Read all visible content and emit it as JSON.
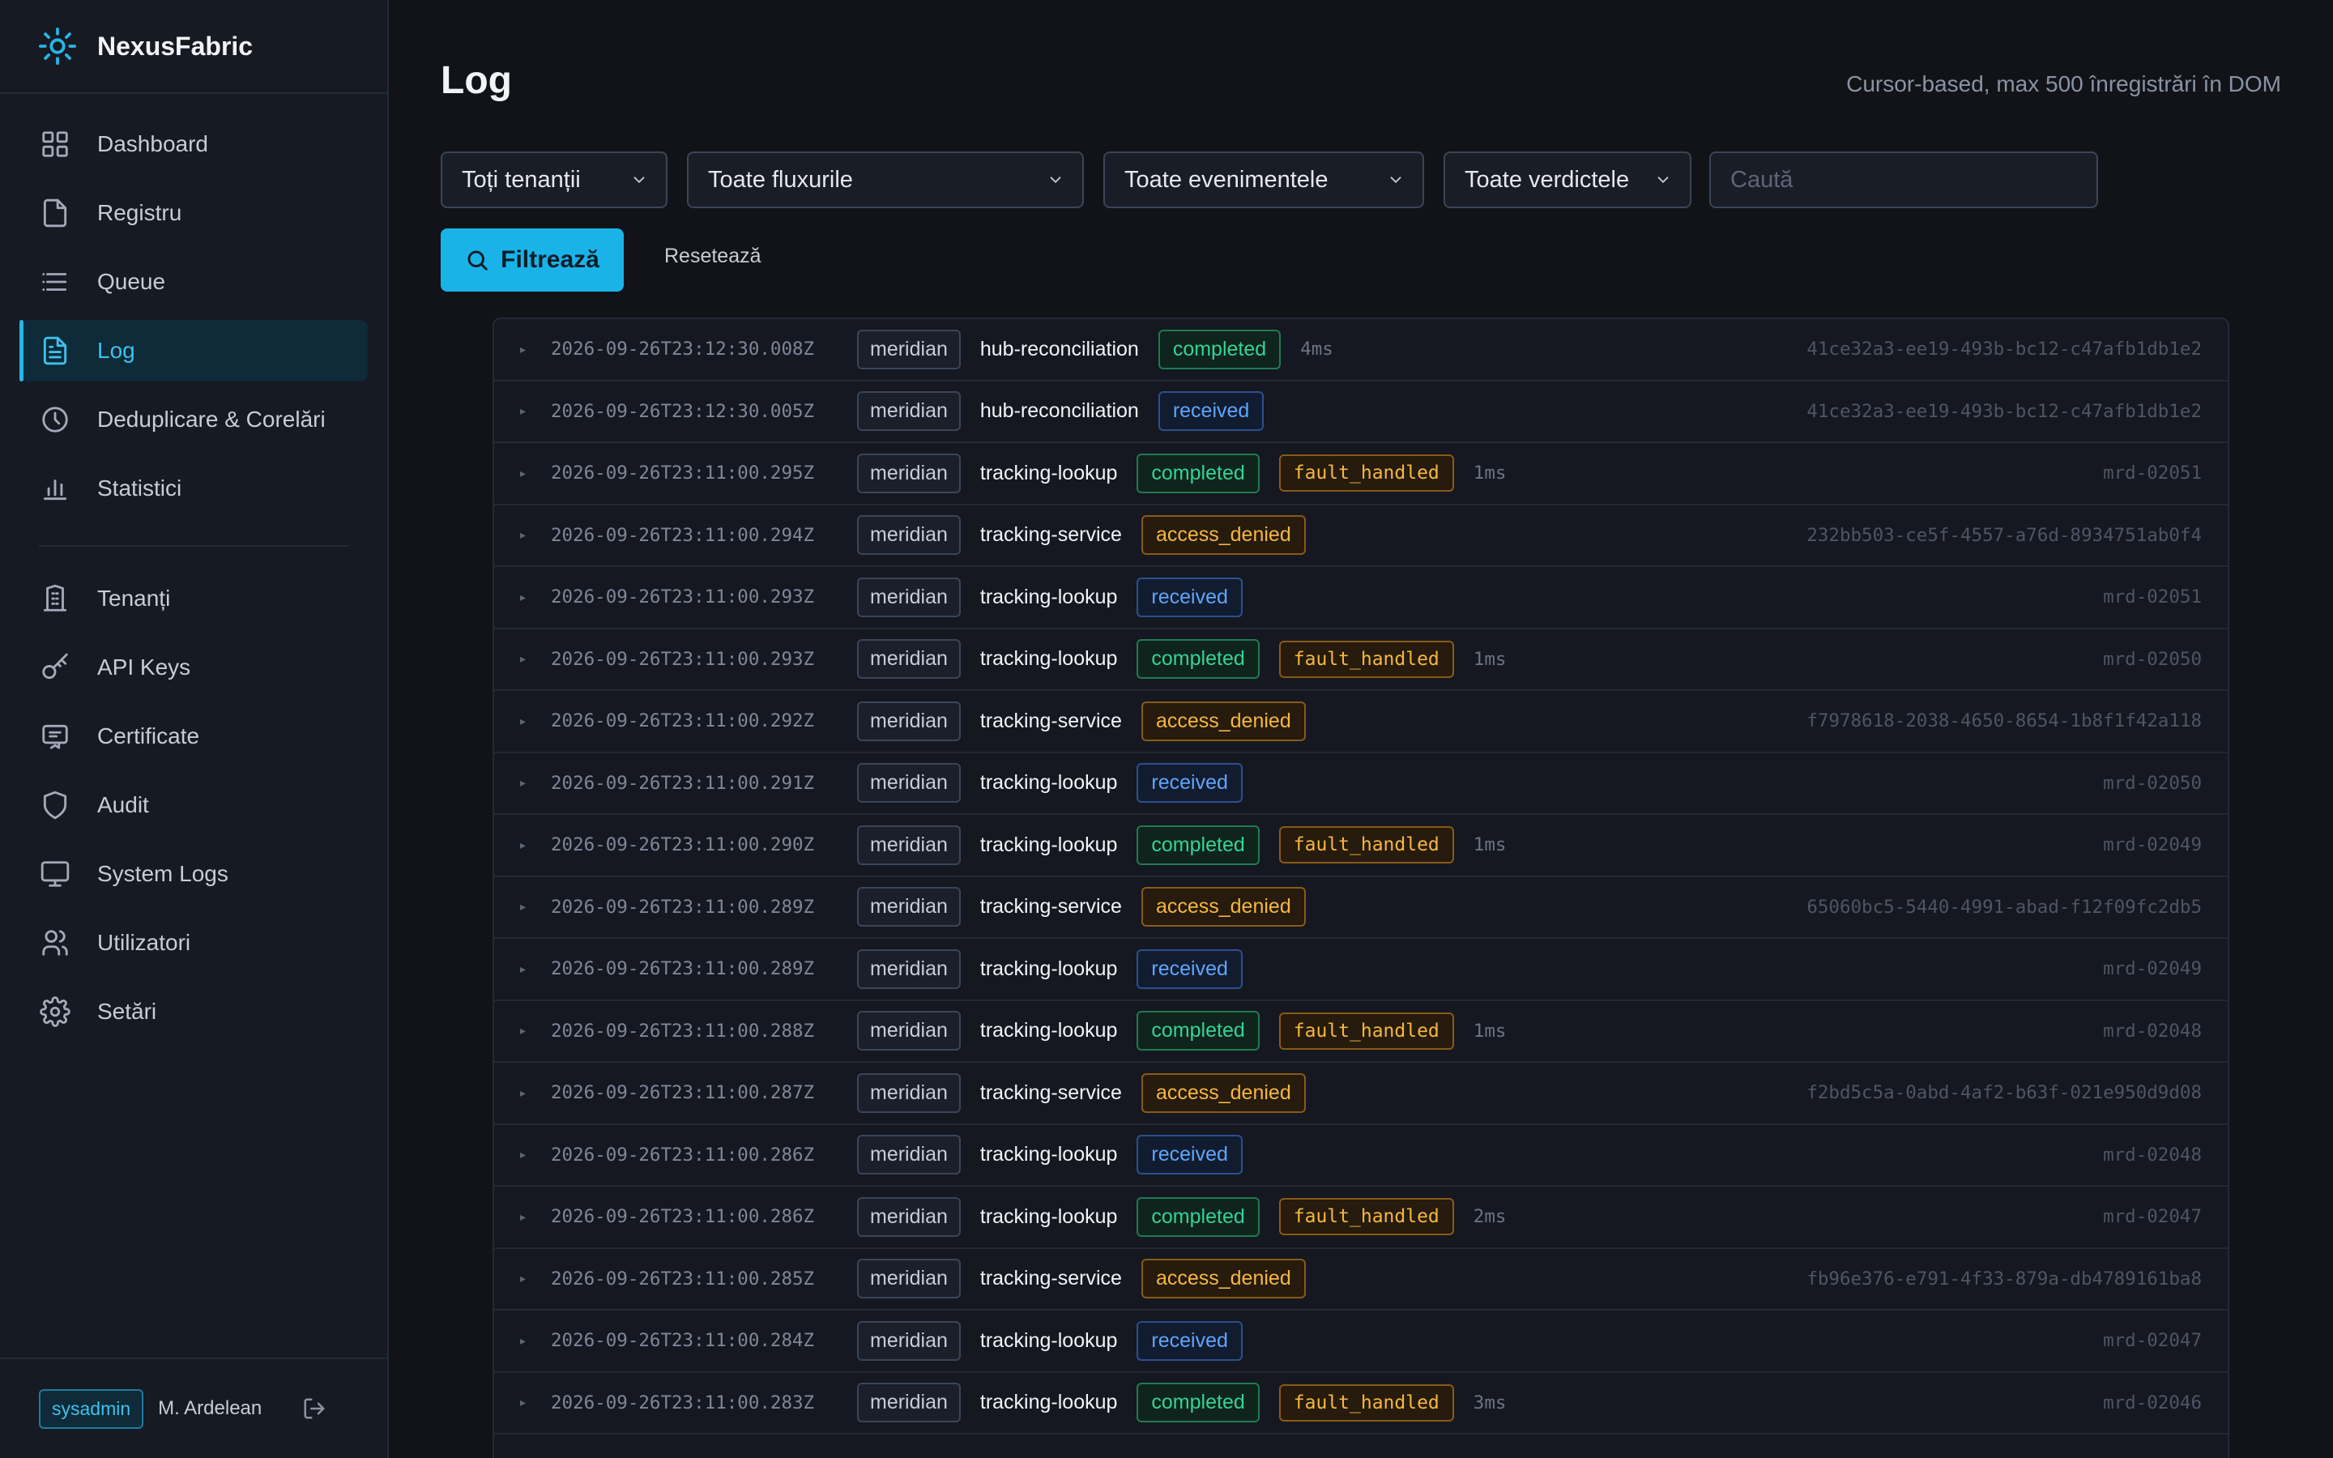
{
  "app": {
    "name": "NexusFabric"
  },
  "sidebar": {
    "main_items": [
      {
        "label": "Dashboard",
        "icon": "grid-icon"
      },
      {
        "label": "Registru",
        "icon": "file-icon"
      },
      {
        "label": "Queue",
        "icon": "list-icon"
      },
      {
        "label": "Log",
        "icon": "file-text-icon",
        "active": true
      },
      {
        "label": "Deduplicare & Corelări",
        "icon": "clock-icon"
      },
      {
        "label": "Statistici",
        "icon": "bar-chart-icon"
      }
    ],
    "admin_items": [
      {
        "label": "Tenanți",
        "icon": "building-icon"
      },
      {
        "label": "API Keys",
        "icon": "key-icon"
      },
      {
        "label": "Certificate",
        "icon": "certificate-icon"
      },
      {
        "label": "Audit",
        "icon": "shield-icon"
      },
      {
        "label": "System Logs",
        "icon": "monitor-icon"
      },
      {
        "label": "Utilizatori",
        "icon": "users-icon"
      },
      {
        "label": "Setări",
        "icon": "gear-icon"
      }
    ]
  },
  "user": {
    "role": "sysadmin",
    "name": "M. Ardelean"
  },
  "page": {
    "title": "Log",
    "subtitle": "Cursor-based, max 500 înregistrări în DOM"
  },
  "filters": {
    "tenant": "Toți tenanții",
    "flow": "Toate fluxurile",
    "event": "Toate evenimentele",
    "verdict": "Toate verdictele",
    "search_placeholder": "Caută",
    "filter_label": "Filtrează",
    "reset_label": "Resetează"
  },
  "colors": {
    "accent": "#1ab3e8",
    "completed": "#34d399",
    "received": "#60a5fa",
    "warning": "#f5b740"
  },
  "rows": [
    {
      "ts": "2026-09-26T23:12:30.008Z",
      "tenant": "meridian",
      "flow": "hub-reconciliation",
      "status": "completed",
      "fault": "",
      "dur": "4ms",
      "id": "41ce32a3-ee19-493b-bc12-c47afb1db1e2"
    },
    {
      "ts": "2026-09-26T23:12:30.005Z",
      "tenant": "meridian",
      "flow": "hub-reconciliation",
      "status": "received",
      "fault": "",
      "dur": "",
      "id": "41ce32a3-ee19-493b-bc12-c47afb1db1e2"
    },
    {
      "ts": "2026-09-26T23:11:00.295Z",
      "tenant": "meridian",
      "flow": "tracking-lookup",
      "status": "completed",
      "fault": "fault_handled",
      "dur": "1ms",
      "id": "mrd-02051"
    },
    {
      "ts": "2026-09-26T23:11:00.294Z",
      "tenant": "meridian",
      "flow": "tracking-service",
      "status": "access_denied",
      "fault": "",
      "dur": "",
      "id": "232bb503-ce5f-4557-a76d-8934751ab0f4"
    },
    {
      "ts": "2026-09-26T23:11:00.293Z",
      "tenant": "meridian",
      "flow": "tracking-lookup",
      "status": "received",
      "fault": "",
      "dur": "",
      "id": "mrd-02051"
    },
    {
      "ts": "2026-09-26T23:11:00.293Z",
      "tenant": "meridian",
      "flow": "tracking-lookup",
      "status": "completed",
      "fault": "fault_handled",
      "dur": "1ms",
      "id": "mrd-02050"
    },
    {
      "ts": "2026-09-26T23:11:00.292Z",
      "tenant": "meridian",
      "flow": "tracking-service",
      "status": "access_denied",
      "fault": "",
      "dur": "",
      "id": "f7978618-2038-4650-8654-1b8f1f42a118"
    },
    {
      "ts": "2026-09-26T23:11:00.291Z",
      "tenant": "meridian",
      "flow": "tracking-lookup",
      "status": "received",
      "fault": "",
      "dur": "",
      "id": "mrd-02050"
    },
    {
      "ts": "2026-09-26T23:11:00.290Z",
      "tenant": "meridian",
      "flow": "tracking-lookup",
      "status": "completed",
      "fault": "fault_handled",
      "dur": "1ms",
      "id": "mrd-02049"
    },
    {
      "ts": "2026-09-26T23:11:00.289Z",
      "tenant": "meridian",
      "flow": "tracking-service",
      "status": "access_denied",
      "fault": "",
      "dur": "",
      "id": "65060bc5-5440-4991-abad-f12f09fc2db5"
    },
    {
      "ts": "2026-09-26T23:11:00.289Z",
      "tenant": "meridian",
      "flow": "tracking-lookup",
      "status": "received",
      "fault": "",
      "dur": "",
      "id": "mrd-02049"
    },
    {
      "ts": "2026-09-26T23:11:00.288Z",
      "tenant": "meridian",
      "flow": "tracking-lookup",
      "status": "completed",
      "fault": "fault_handled",
      "dur": "1ms",
      "id": "mrd-02048"
    },
    {
      "ts": "2026-09-26T23:11:00.287Z",
      "tenant": "meridian",
      "flow": "tracking-service",
      "status": "access_denied",
      "fault": "",
      "dur": "",
      "id": "f2bd5c5a-0abd-4af2-b63f-021e950d9d08"
    },
    {
      "ts": "2026-09-26T23:11:00.286Z",
      "tenant": "meridian",
      "flow": "tracking-lookup",
      "status": "received",
      "fault": "",
      "dur": "",
      "id": "mrd-02048"
    },
    {
      "ts": "2026-09-26T23:11:00.286Z",
      "tenant": "meridian",
      "flow": "tracking-lookup",
      "status": "completed",
      "fault": "fault_handled",
      "dur": "2ms",
      "id": "mrd-02047"
    },
    {
      "ts": "2026-09-26T23:11:00.285Z",
      "tenant": "meridian",
      "flow": "tracking-service",
      "status": "access_denied",
      "fault": "",
      "dur": "",
      "id": "fb96e376-e791-4f33-879a-db4789161ba8"
    },
    {
      "ts": "2026-09-26T23:11:00.284Z",
      "tenant": "meridian",
      "flow": "tracking-lookup",
      "status": "received",
      "fault": "",
      "dur": "",
      "id": "mrd-02047"
    },
    {
      "ts": "2026-09-26T23:11:00.283Z",
      "tenant": "meridian",
      "flow": "tracking-lookup",
      "status": "completed",
      "fault": "fault_handled",
      "dur": "3ms",
      "id": "mrd-02046"
    }
  ]
}
